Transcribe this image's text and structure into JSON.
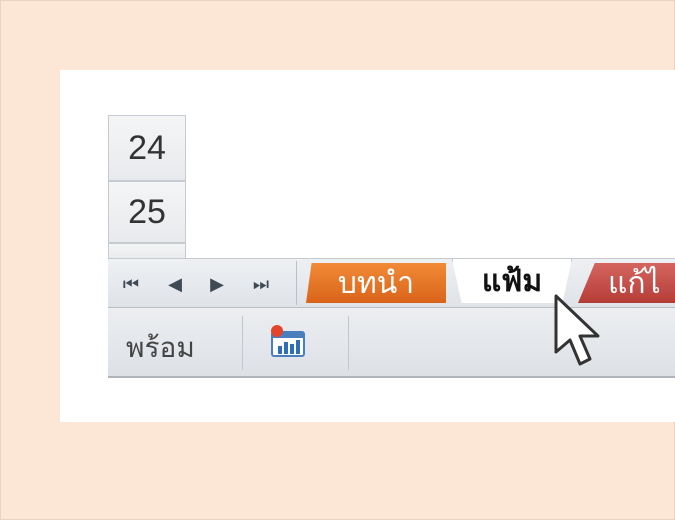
{
  "rows": [
    "24",
    "25"
  ],
  "nav": {
    "first": "⏮",
    "prev": "◀",
    "next": "▶",
    "last": "⏭"
  },
  "sheet_tabs": [
    {
      "label": "บทนำ",
      "state": "inactive",
      "color": "#e87726"
    },
    {
      "label": "แฟ้ม",
      "state": "active",
      "color": "#ffffff"
    },
    {
      "label": "แก้ไ",
      "state": "inactive",
      "color": "#c44d48"
    }
  ],
  "status": {
    "ready_text": "พร้อม",
    "macro_icon": "record-macro-icon"
  },
  "colors": {
    "background": "#fce6d6",
    "orange_tab": "#e87726",
    "red_tab": "#c44d48"
  }
}
